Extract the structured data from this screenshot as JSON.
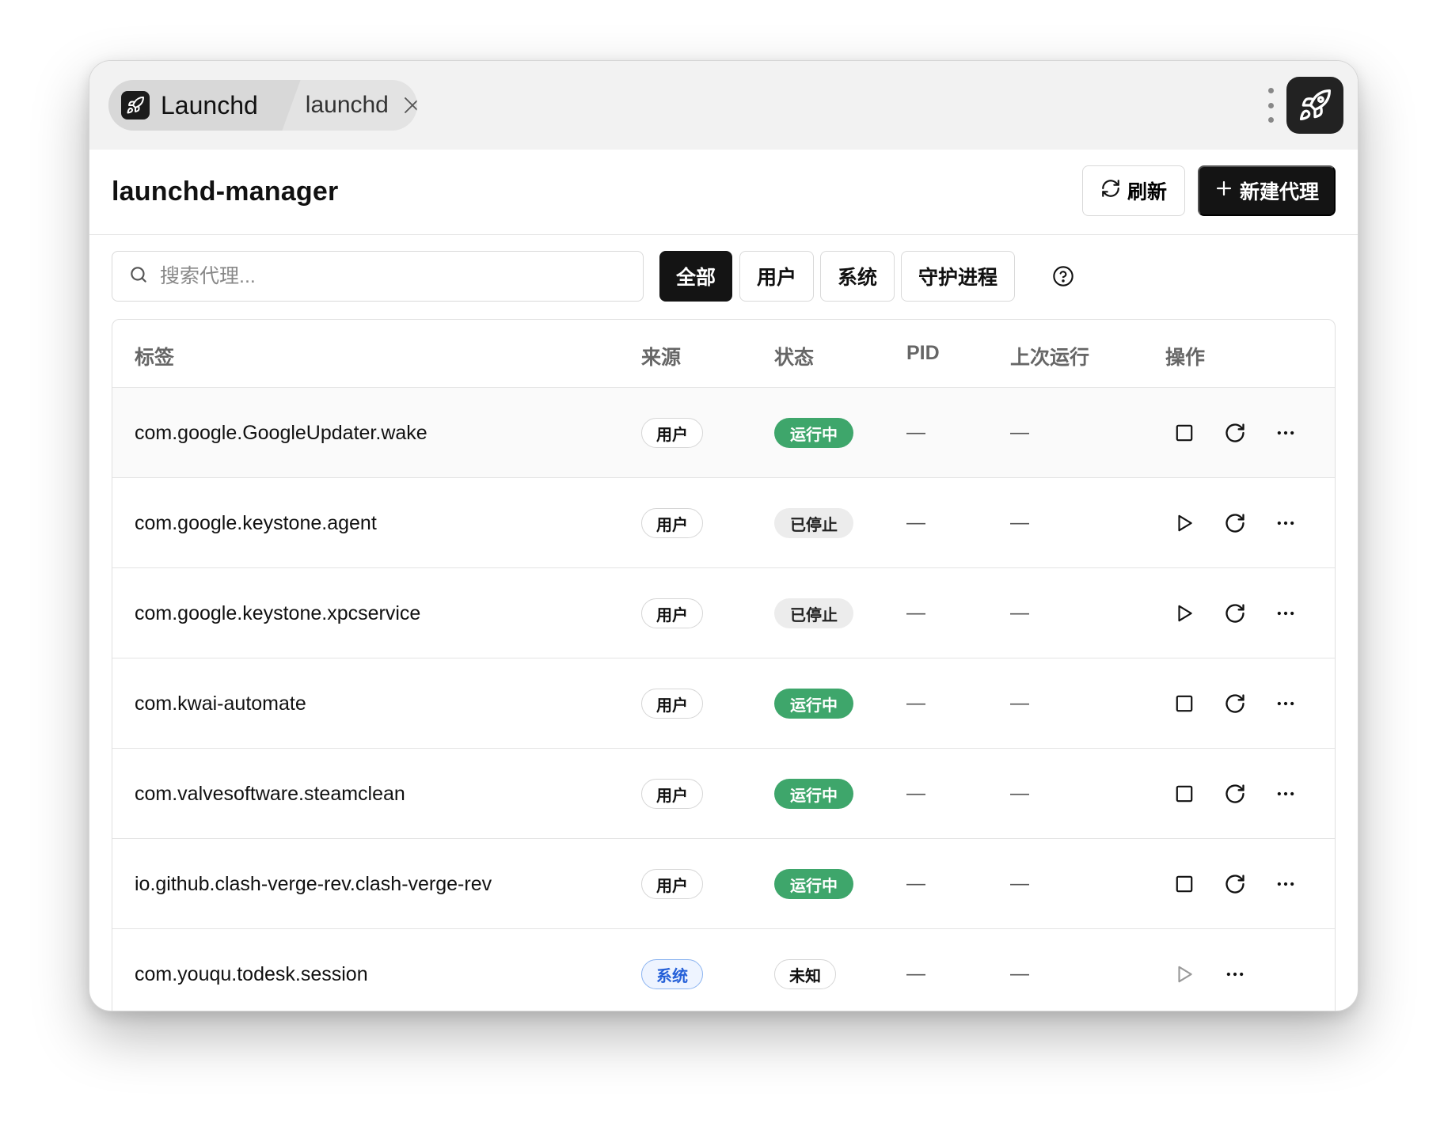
{
  "tabs": {
    "app_name": "Launchd",
    "second_tab": "launchd"
  },
  "icons": {
    "app": "rocket-icon",
    "close": "close-icon",
    "menu": "kebab-icon",
    "refresh": "refresh-icon",
    "add": "plus-icon",
    "search": "search-icon",
    "help": "help-circle-icon",
    "stop": "stop-square-icon",
    "start": "play-icon",
    "restart": "restart-icon",
    "more": "more-horizontal-icon"
  },
  "header": {
    "title": "launchd-manager",
    "refresh_label": "刷新",
    "new_label": "新建代理"
  },
  "toolbar": {
    "search_placeholder": "搜索代理...",
    "filters": [
      "全部",
      "用户",
      "系统",
      "守护进程"
    ],
    "active_filter": "全部"
  },
  "table": {
    "columns": {
      "label": "标签",
      "source": "来源",
      "status": "状态",
      "pid": "PID",
      "last_run": "上次运行",
      "actions": "操作"
    },
    "rows": [
      {
        "label": "com.google.GoogleUpdater.wake",
        "source": "用户",
        "source_type": "user",
        "status": "运行中",
        "status_type": "running",
        "pid": "—",
        "last_run": "—"
      },
      {
        "label": "com.google.keystone.agent",
        "source": "用户",
        "source_type": "user",
        "status": "已停止",
        "status_type": "stopped",
        "pid": "—",
        "last_run": "—"
      },
      {
        "label": "com.google.keystone.xpcservice",
        "source": "用户",
        "source_type": "user",
        "status": "已停止",
        "status_type": "stopped",
        "pid": "—",
        "last_run": "—"
      },
      {
        "label": "com.kwai-automate",
        "source": "用户",
        "source_type": "user",
        "status": "运行中",
        "status_type": "running",
        "pid": "—",
        "last_run": "—"
      },
      {
        "label": "com.valvesoftware.steamclean",
        "source": "用户",
        "source_type": "user",
        "status": "运行中",
        "status_type": "running",
        "pid": "—",
        "last_run": "—"
      },
      {
        "label": "io.github.clash-verge-rev.clash-verge-rev",
        "source": "用户",
        "source_type": "user",
        "status": "运行中",
        "status_type": "running",
        "pid": "—",
        "last_run": "—"
      },
      {
        "label": "com.youqu.todesk.session",
        "source": "系统",
        "source_type": "system",
        "status": "未知",
        "status_type": "unknown",
        "pid": "—",
        "last_run": "—"
      }
    ]
  },
  "colors": {
    "running": "#3ea66b",
    "system_accent": "#2560d8",
    "primary_button": "#141414"
  }
}
